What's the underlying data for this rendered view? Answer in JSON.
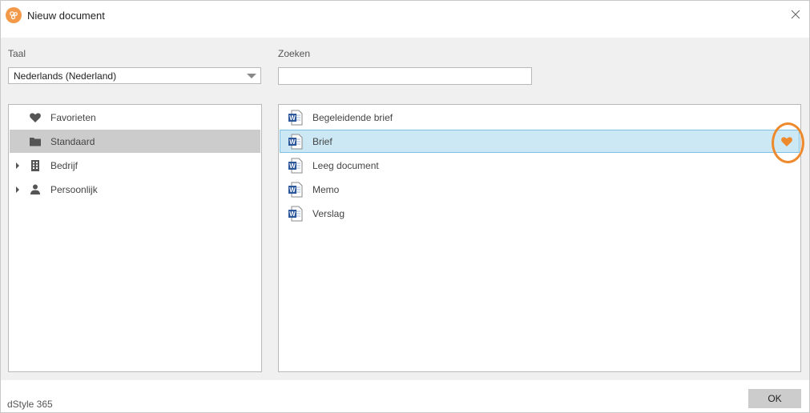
{
  "window": {
    "title": "Nieuw document"
  },
  "language": {
    "label": "Taal",
    "selected": "Nederlands (Nederland)"
  },
  "search": {
    "label": "Zoeken",
    "value": "",
    "placeholder": ""
  },
  "categories": [
    {
      "label": "Favorieten",
      "icon": "heart-icon",
      "selected": false,
      "expandable": false
    },
    {
      "label": "Standaard",
      "icon": "folder-icon",
      "selected": true,
      "expandable": false
    },
    {
      "label": "Bedrijf",
      "icon": "building-icon",
      "selected": false,
      "expandable": true
    },
    {
      "label": "Persoonlijk",
      "icon": "person-icon",
      "selected": false,
      "expandable": true
    }
  ],
  "templates": [
    {
      "label": "Begeleidende brief",
      "icon": "word-document-icon",
      "selected": false
    },
    {
      "label": "Brief",
      "icon": "word-document-icon",
      "selected": true,
      "favorite": true
    },
    {
      "label": "Leeg document",
      "icon": "word-document-icon",
      "selected": false
    },
    {
      "label": "Memo",
      "icon": "word-document-icon",
      "selected": false
    },
    {
      "label": "Verslag",
      "icon": "word-document-icon",
      "selected": false
    }
  ],
  "footer": {
    "brand": "dStyle 365",
    "ok_label": "OK"
  },
  "colors": {
    "accent": "#ef8a2c",
    "selection": "#cce8f5",
    "selection_border": "#7dc1e4",
    "word_blue": "#2b579a"
  }
}
